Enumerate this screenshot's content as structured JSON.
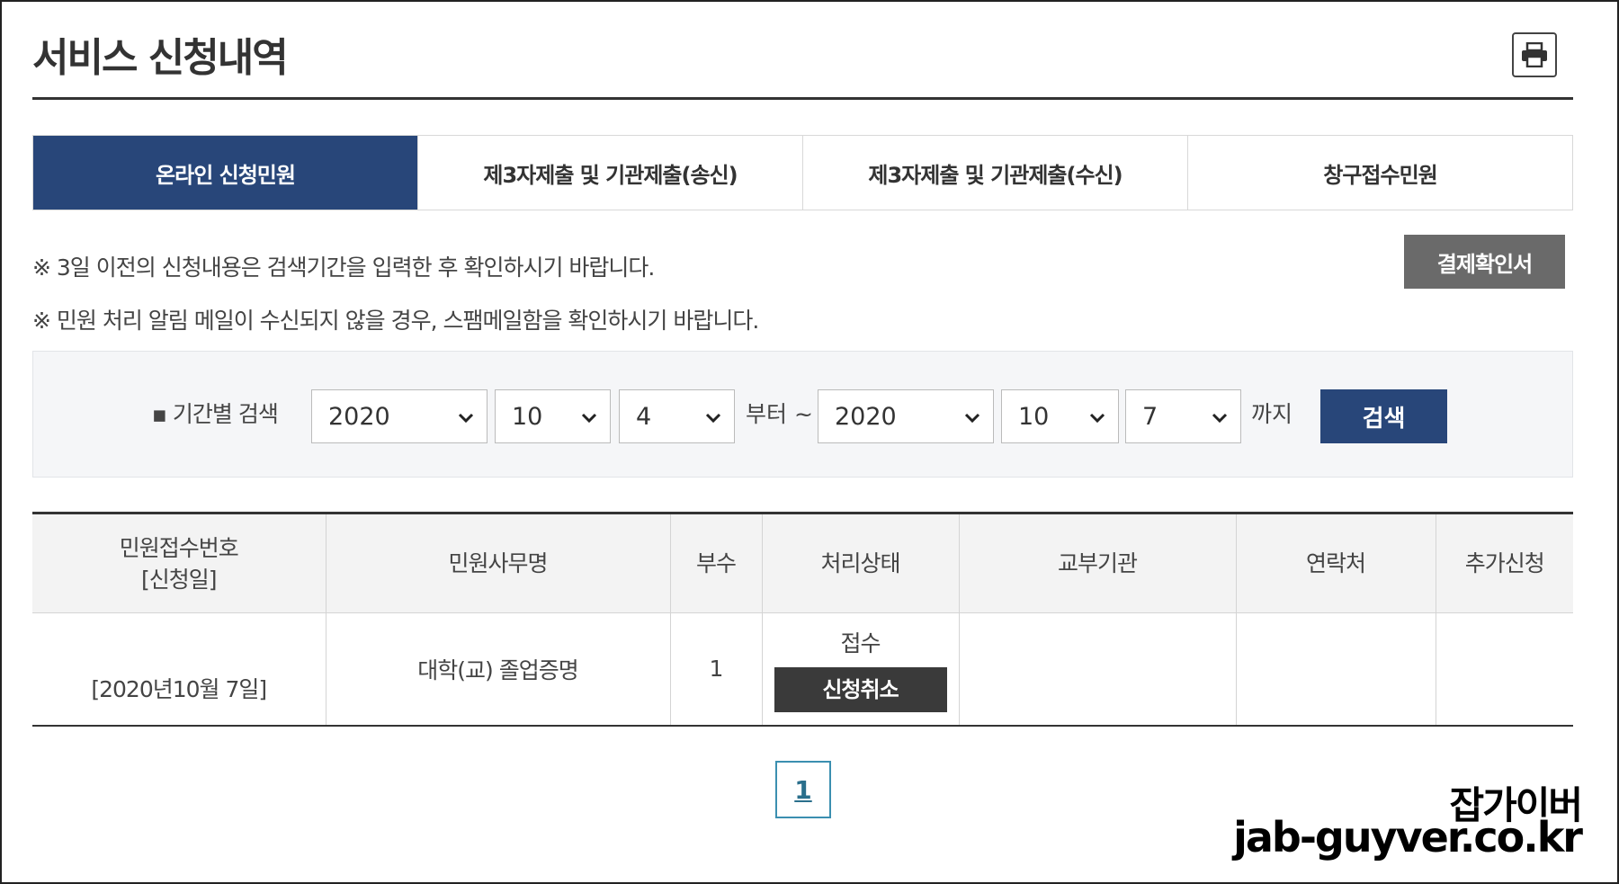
{
  "page": {
    "title": "서비스 신청내역"
  },
  "tabs": [
    {
      "label": "온라인 신청민원",
      "active": true
    },
    {
      "label": "제3자제출 및 기관제출(송신)",
      "active": false
    },
    {
      "label": "제3자제출 및 기관제출(수신)",
      "active": false
    },
    {
      "label": "창구접수민원",
      "active": false
    }
  ],
  "notices": [
    "※ 3일 이전의 신청내용은 검색기간을 입력한 후 확인하시기 바랍니다.",
    "※ 민원 처리 알림 메일이 수신되지 않을 경우, 스팸메일함을 확인하시기 바랍니다."
  ],
  "payment_button": "결제확인서",
  "search": {
    "label": "▪ 기간별 검색",
    "from_year": "2020",
    "from_month": "10",
    "from_day": "4",
    "from_text": "부터 ~",
    "to_year": "2020",
    "to_month": "10",
    "to_day": "7",
    "to_text": "까지",
    "button": "검색"
  },
  "table": {
    "headers": {
      "receipt_no": "민원접수번호",
      "receipt_date": "[신청일]",
      "name": "민원사무명",
      "copies": "부수",
      "status": "처리상태",
      "agency": "교부기관",
      "contact": "연락처",
      "extra": "추가신청"
    },
    "rows": [
      {
        "date": "[2020년10월 7일]",
        "name": "대학(교) 졸업증명",
        "copies": "1",
        "status": "접수",
        "cancel": "신청취소"
      }
    ]
  },
  "pagination": {
    "current": "1"
  },
  "watermark": {
    "line1": "잡가이버",
    "line2": "jab-guyver.co.kr"
  },
  "colors": {
    "primary": "#284679",
    "dark_button": "#3a3a3a",
    "gray_button": "#6a6a6a"
  }
}
